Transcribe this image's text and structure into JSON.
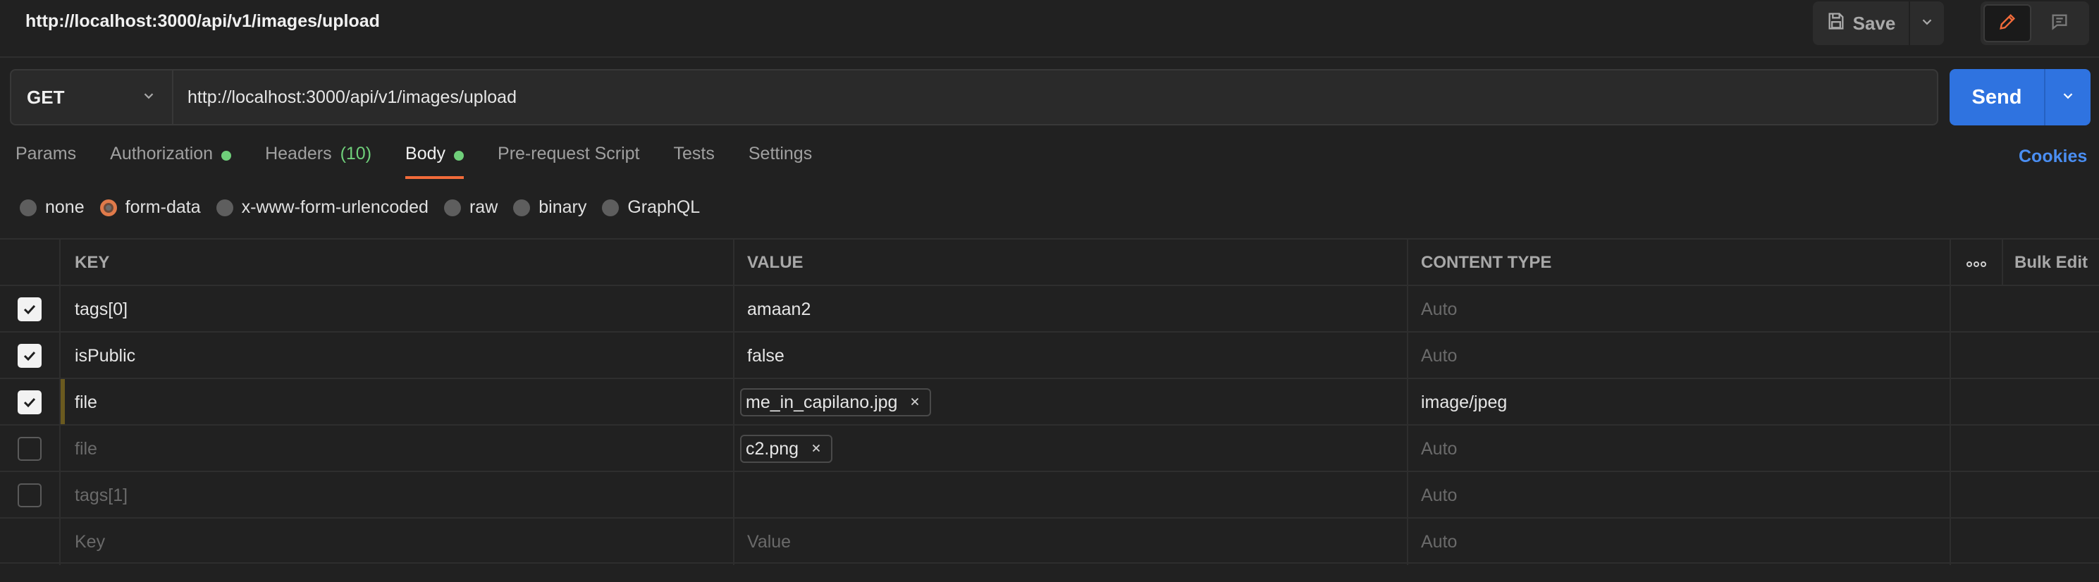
{
  "header": {
    "title": "http://localhost:3000/api/v1/images/upload",
    "save_label": "Save"
  },
  "request": {
    "method": "GET",
    "url": "http://localhost:3000/api/v1/images/upload",
    "send_label": "Send"
  },
  "tabs": {
    "params": "Params",
    "authorization": "Authorization",
    "headers": "Headers",
    "headers_count": "(10)",
    "body": "Body",
    "prerequest": "Pre-request Script",
    "tests": "Tests",
    "settings": "Settings",
    "active": "Body"
  },
  "cookies_label": "Cookies",
  "body_types": {
    "none": "none",
    "form_data": "form-data",
    "urlencoded": "x-www-form-urlencoded",
    "raw": "raw",
    "binary": "binary",
    "graphql": "GraphQL",
    "selected": "form-data"
  },
  "table": {
    "headers": {
      "key": "KEY",
      "value": "VALUE",
      "content_type": "CONTENT TYPE",
      "bulk_edit": "Bulk Edit"
    },
    "rows": [
      {
        "checked": true,
        "key": "tags[0]",
        "value": "amaan2",
        "value_is_file": false,
        "content_type": "Auto"
      },
      {
        "checked": true,
        "key": "isPublic",
        "value": "false",
        "value_is_file": false,
        "content_type": "Auto"
      },
      {
        "checked": true,
        "key": "file",
        "value": "me_in_capilano.jpg",
        "value_is_file": true,
        "content_type": "image/jpeg"
      },
      {
        "checked": false,
        "key": "file",
        "value": "c2.png",
        "value_is_file": true,
        "content_type": "Auto"
      },
      {
        "checked": false,
        "key": "tags[1]",
        "value": "",
        "value_is_file": false,
        "content_type": "Auto"
      }
    ],
    "placeholder": {
      "key": "Key",
      "value": "Value",
      "content_type": "Auto"
    }
  },
  "colors": {
    "accent_orange": "#f26b3a",
    "send_blue": "#2f73e0",
    "status_green": "#6fcf7a",
    "link_blue": "#4a8ef2"
  }
}
